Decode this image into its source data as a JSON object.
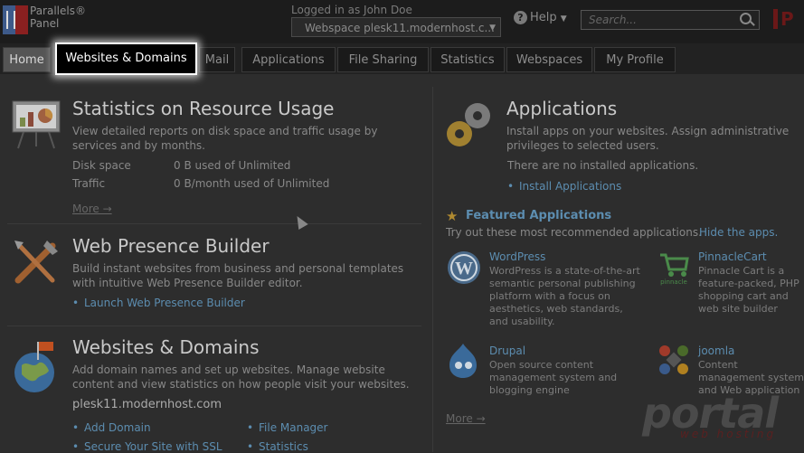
{
  "header": {
    "brand_line1": "Parallels®",
    "brand_line2": "Panel",
    "logged_in": "Logged in as  John Doe",
    "webspace": "Webspace  plesk11.modernhost.c...",
    "help": "Help",
    "search_placeholder": "Search...",
    "corner_text": "P"
  },
  "tabs": [
    {
      "label": "Home"
    },
    {
      "label": "Websites & Domains"
    },
    {
      "label": "Mail"
    },
    {
      "label": "Applications"
    },
    {
      "label": "File Sharing"
    },
    {
      "label": "Statistics"
    },
    {
      "label": "Webspaces"
    },
    {
      "label": "My Profile"
    }
  ],
  "stats": {
    "title": "Statistics on Resource Usage",
    "desc": "View detailed reports on disk space and traffic usage by services and by months.",
    "disk_label": "Disk space",
    "disk_value": "0 B used of Unlimited",
    "traffic_label": "Traffic",
    "traffic_value": "0 B/month used of Unlimited",
    "more": "More →"
  },
  "builder": {
    "title": "Web Presence Builder",
    "desc": "Build instant websites from business and personal templates with intuitive Web Presence Builder editor.",
    "link": "Launch Web Presence Builder"
  },
  "domains": {
    "title": "Websites & Domains",
    "desc": "Add domain names and set up websites. Manage website content and view statistics on how people visit your websites.",
    "domain": "plesk11.modernhost.com",
    "links": [
      "Add Domain",
      "File Manager",
      "Secure Your Site with SSL",
      "Statistics"
    ]
  },
  "applications": {
    "title": "Applications",
    "desc": "Install apps on your websites. Assign administrative privileges to selected users.",
    "none": "There are no installed applications.",
    "install_link": "Install Applications",
    "featured_title": "Featured Applications",
    "featured_desc": "Try out these most recommended applications.",
    "hide_link": "Hide the apps.",
    "more": "More →",
    "apps": [
      {
        "name": "WordPress",
        "desc": "WordPress is a state-of-the-art semantic personal publishing platform with a focus on aesthetics, web standards, and usability."
      },
      {
        "name": "PinnacleCart",
        "desc": "Pinnacle Cart is a feature-packed, PHP shopping cart and web site builder application"
      },
      {
        "name": "Drupal",
        "desc": "Open source content management system and blogging engine"
      },
      {
        "name": "joomla",
        "desc": "Content management system and Web application framework"
      }
    ]
  },
  "watermark": {
    "line1": "portal",
    "line2": "web hosting"
  },
  "colors": {
    "accent": "#5c8db0",
    "brand_red": "#8a2020",
    "brand_blue": "#3d5a8a"
  }
}
